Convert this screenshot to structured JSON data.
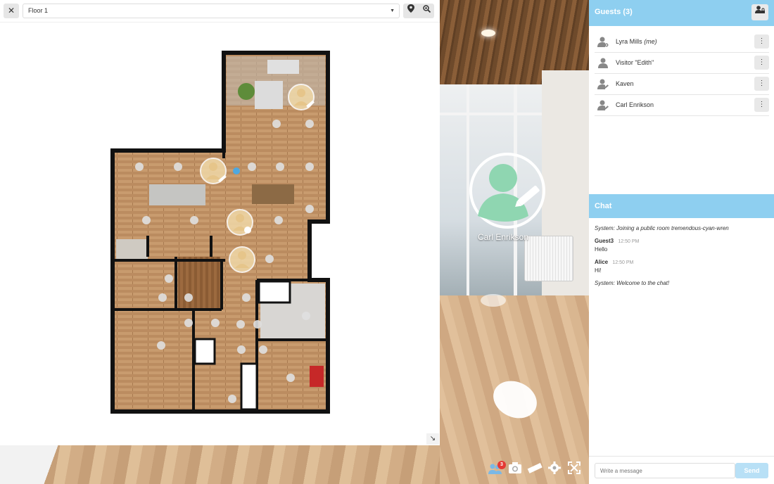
{
  "map": {
    "close_icon": "close-icon",
    "floor_selected": "Floor 1",
    "tools": [
      "location-pin-icon",
      "zoom-icon"
    ],
    "resize_icon": "resize-arrow-icon"
  },
  "viewer": {
    "avatar_name": "Carl Enrikson"
  },
  "guests": {
    "title": "Guests (3)",
    "action_icon": "user-lock-icon",
    "list": [
      {
        "name": "Lyra Mills",
        "suffix": "(me)",
        "icon": "user-gear-icon"
      },
      {
        "name": "Visitor \"Edith\"",
        "suffix": "",
        "icon": "user-icon"
      },
      {
        "name": "Kaven",
        "suffix": "",
        "icon": "user-edit-icon"
      },
      {
        "name": "Carl Enrikson",
        "suffix": "",
        "icon": "user-edit-icon"
      }
    ]
  },
  "chat": {
    "title": "Chat",
    "messages": [
      {
        "type": "system",
        "text": "System: Joining a public room tremendous-cyan-wren"
      },
      {
        "type": "user",
        "author": "Guest3",
        "time": "12:50 PM",
        "text": "Hello"
      },
      {
        "type": "user",
        "author": "Alice",
        "time": "12:50 PM",
        "text": "Hi!"
      },
      {
        "type": "system",
        "text": "System: Welcome to the chat!"
      }
    ],
    "input_placeholder": "Write a message",
    "send_label": "Send"
  },
  "toolbar": {
    "guests_badge": "3",
    "icons": [
      "guests-icon",
      "camera-icon",
      "ruler-icon",
      "settings-icon",
      "fullscreen-icon"
    ]
  },
  "colors": {
    "header_blue": "#8ecff0",
    "badge_red": "#e53935",
    "avatar_green": "#8fd6b1"
  }
}
